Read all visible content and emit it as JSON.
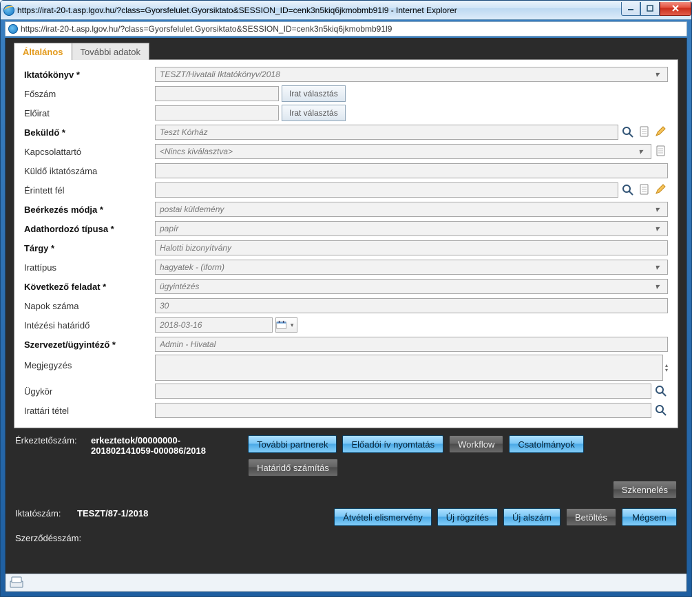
{
  "window": {
    "title": "https://irat-20-t.asp.lgov.hu/?class=Gyorsfelulet.Gyorsiktato&SESSION_ID=cenk3n5kiq6jkmobmb91l9 - Internet Explorer",
    "url": "https://irat-20-t.asp.lgov.hu/?class=Gyorsfelulet.Gyorsiktato&SESSION_ID=cenk3n5kiq6jkmobmb91l9"
  },
  "tabs": {
    "active": "Általános",
    "other": "További adatok"
  },
  "form": {
    "iktatokonyv": {
      "label": "Iktatókönyv *",
      "value": "TESZT/Hivatali Iktatókönyv/2018"
    },
    "foszam": {
      "label": "Főszám",
      "value": "",
      "btn": "Irat választás"
    },
    "eloirat": {
      "label": "Előirat",
      "value": "",
      "btn": "Irat választás"
    },
    "bekuldo": {
      "label": "Beküldő *",
      "value": "Teszt Kórház"
    },
    "kapcsolattarto": {
      "label": "Kapcsolattartó",
      "value": "<Nincs kiválasztva>"
    },
    "kuldoikt": {
      "label": "Küldő iktatószáma",
      "value": ""
    },
    "erintett": {
      "label": "Érintett fél",
      "value": ""
    },
    "beerkezes": {
      "label": "Beérkezés módja *",
      "value": "postai küldemény"
    },
    "adathordozo": {
      "label": "Adathordozó típusa *",
      "value": "papír"
    },
    "targy": {
      "label": "Tárgy *",
      "value": "Halotti bizonyítvány"
    },
    "irattipus": {
      "label": "Irattípus",
      "value": "hagyatek - (iform)"
    },
    "kovfeladat": {
      "label": "Következő feladat *",
      "value": "ügyintézés"
    },
    "napok": {
      "label": "Napok száma",
      "value": "30"
    },
    "hatarido": {
      "label": "Intézési határidő",
      "value": "2018-03-16"
    },
    "szerv": {
      "label": "Szervezet/ügyintéző *",
      "value": "Admin - Hivatal"
    },
    "megj": {
      "label": "Megjegyzés",
      "value": ""
    },
    "ugykor": {
      "label": "Ügykör",
      "value": ""
    },
    "irattari": {
      "label": "Irattári tétel",
      "value": ""
    }
  },
  "footer": {
    "erk_label": "Érkeztetőszám:",
    "erk_value": "erkeztetok/00000000-201802141059-000086/2018",
    "ikt_label": "Iktatószám:",
    "ikt_value": "TESZT/87-1/2018",
    "szerz_label": "Szerződésszám:",
    "szerz_value": "",
    "buttons": {
      "tovabbi": "További partnerek",
      "eloadoi": "Előadói ív nyomtatás",
      "workflow": "Workflow",
      "csat": "Csatolmányok",
      "hatarido": "Határidő számítás",
      "szken": "Szkennelés",
      "atveteli": "Átvételi elismervény",
      "ujrogz": "Új rögzítés",
      "ujalszam": "Új alszám",
      "betoltes": "Betöltés",
      "megsem": "Mégsem"
    }
  }
}
